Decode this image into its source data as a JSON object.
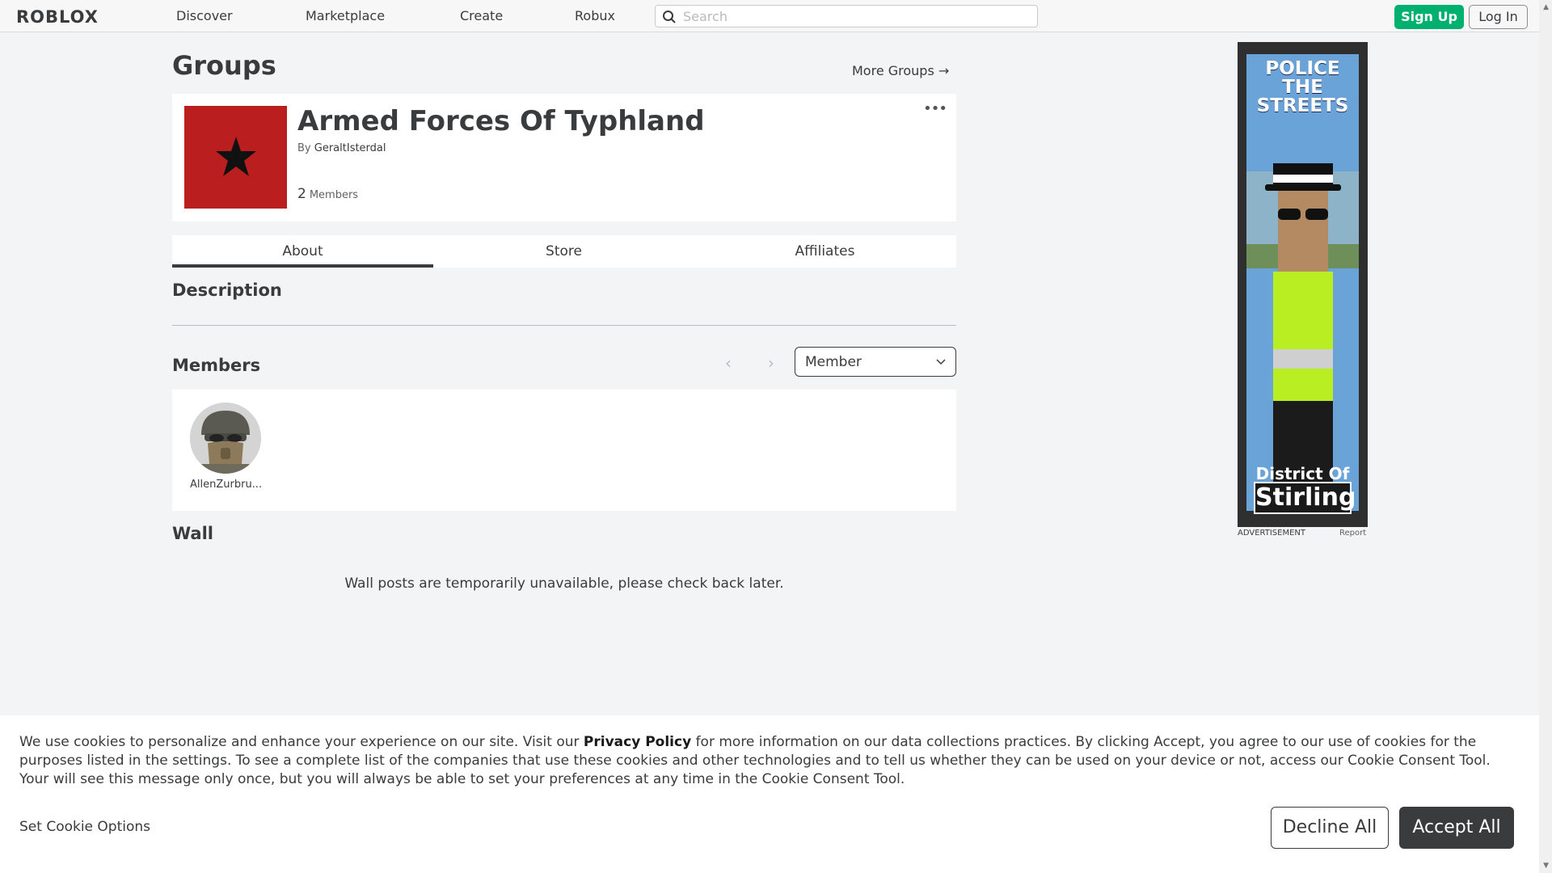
{
  "nav": {
    "logo": "ROBLOX",
    "links": [
      "Discover",
      "Marketplace",
      "Create",
      "Robux"
    ],
    "search_placeholder": "Search",
    "signup": "Sign Up",
    "login": "Log In"
  },
  "page": {
    "title": "Groups",
    "more_groups": "More Groups →"
  },
  "group": {
    "name": "Armed Forces Of Typhland",
    "by_label": "By",
    "owner": "GeraltIsterdal",
    "member_count": "2",
    "members_label": "Members",
    "emblem_color": "#bb1e1e"
  },
  "tabs": [
    "About",
    "Store",
    "Affiliates"
  ],
  "sections": {
    "description": "Description",
    "members": "Members",
    "wall": "Wall"
  },
  "members": {
    "role_filter": "Member",
    "list": [
      {
        "name": "AllenZurbru..."
      }
    ]
  },
  "wall": {
    "message": "Wall posts are temporarily unavailable, please check back later."
  },
  "ad": {
    "headline": "POLICE THE STREETS",
    "footer_line1": "District Of",
    "footer_line2": "Stirling",
    "label": "ADVERTISEMENT",
    "report": "Report"
  },
  "cookie": {
    "text_before": "We use cookies to personalize and enhance your experience on our site. Visit our ",
    "link": "Privacy Policy",
    "text_after": " for more information on our data collections practices. By clicking Accept, you agree to our use of cookies for the purposes listed in the settings. To see a complete list of the companies that use these cookies and other technologies and to tell us whether they can be used on your device or not, access our Cookie Consent Tool. Your will see this message only once, but you will always be able to set your preferences at any time in the Cookie Consent Tool.",
    "options": "Set Cookie Options",
    "decline": "Decline All",
    "accept": "Accept All"
  },
  "colors": {
    "accent_green": "#00b06f",
    "text": "#393b3d",
    "background": "#f2f4f5"
  }
}
